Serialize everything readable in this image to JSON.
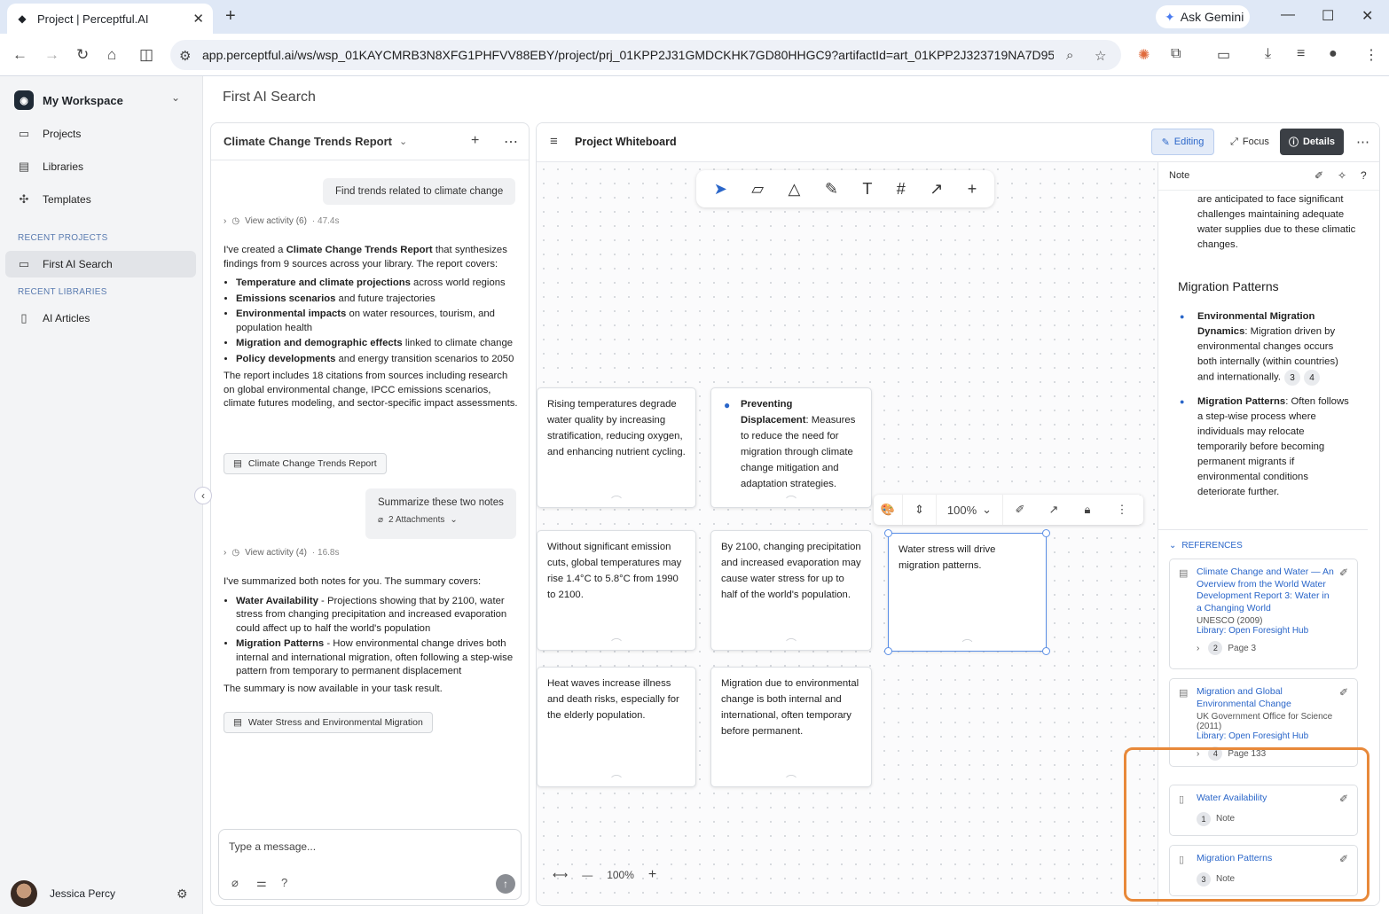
{
  "browser": {
    "tab_title": "Project | Perceptful.AI",
    "ask_gemini": "Ask Gemini",
    "url": "app.perceptful.ai/ws/wsp_01KAYCMRB3N8XFG1PHFVV88EBY/project/prj_01KPP2J31GMDCKHK7GD80HHGC9?artifactId=art_01KPP2J323719NA7D95XEYX..."
  },
  "sidebar": {
    "workspace": "My Workspace",
    "items": [
      {
        "label": "Projects",
        "icon": "folder-icon"
      },
      {
        "label": "Libraries",
        "icon": "library-icon"
      },
      {
        "label": "Templates",
        "icon": "templates-icon"
      }
    ],
    "recent_projects_label": "RECENT PROJECTS",
    "recent_projects": [
      "First AI Search"
    ],
    "recent_libraries_label": "RECENT LIBRARIES",
    "recent_libraries": [
      "AI Articles"
    ],
    "user_name": "Jessica Percy"
  },
  "page_title": "First AI Search",
  "chat": {
    "title": "Climate Change Trends Report",
    "user_msg_1": "Find trends related to climate change",
    "activity_1": "View activity (6)",
    "activity_1_time": "· 47.4s",
    "reply_1_intro_a": "I've created a ",
    "reply_1_intro_b": "Climate Change Trends Report",
    "reply_1_intro_c": " that synthesizes findings from 9 sources across your library. The report covers:",
    "reply_1_bullets": [
      {
        "b": "Temperature and climate projections",
        "t": " across world regions"
      },
      {
        "b": "Emissions scenarios",
        "t": " and future trajectories"
      },
      {
        "b": "Environmental impacts",
        "t": " on water resources, tourism, and population health"
      },
      {
        "b": "Migration and demographic effects",
        "t": " linked to climate change"
      },
      {
        "b": "Policy developments",
        "t": " and energy transition scenarios to 2050"
      }
    ],
    "reply_1_outro": "The report includes 18 citations from sources including research on global environmental change, IPCC emissions scenarios, climate futures modeling, and sector-specific impact assessments.",
    "artifact_1": "Climate Change Trends Report",
    "user_msg_2": "Summarize these two notes",
    "attachments": "2 Attachments",
    "activity_2": "View activity (4)",
    "activity_2_time": "· 16.8s",
    "reply_2_intro": "I've summarized both notes for you. The summary covers:",
    "reply_2_bullets": [
      {
        "b": "Water Availability",
        "t": " - Projections showing that by 2100, water stress from changing precipitation and increased evaporation could affect up to half the world's population"
      },
      {
        "b": "Migration Patterns",
        "t": " - How environmental change drives both internal and international migration, often following a step-wise pattern from temporary to permanent displacement"
      }
    ],
    "reply_2_outro": "The summary is now available in your task result.",
    "artifact_2": "Water Stress and Environmental Migration",
    "composer_placeholder": "Type a message..."
  },
  "whiteboard": {
    "title": "Project Whiteboard",
    "editing": "Editing",
    "focus": "Focus",
    "details": "Details",
    "zoom": "100%",
    "note_zoom": "100%",
    "notes": {
      "n1": "Rising temperatures degrade water quality by increasing stratification, reducing oxygen, and enhancing nutrient cycling.",
      "n2_bold": "Preventing Displacement",
      "n2_text": ": Measures to reduce the need for migration through climate change mitigation and adaptation strategies.",
      "n3": "Without significant emission cuts, global temperatures may rise 1.4°C to 5.8°C from 1990 to 2100.",
      "n4": "By 2100, changing precipitation and increased evaporation may cause water stress for up to half of the world's population.",
      "n5": "Water stress will drive migration patterns.",
      "n6": "Heat waves increase illness and death risks, especially for the elderly population.",
      "n7": "Migration due to environmental change is both internal and international, often temporary before permanent."
    }
  },
  "details_panel": {
    "header": "Note",
    "top_text": "are anticipated to face significant challenges maintaining adequate water supplies due to these climatic changes.",
    "section_title": "Migration Patterns",
    "bullets": [
      {
        "b": "Environmental Migration Dynamics",
        "t": ": Migration driven by environmental changes occurs both internally (within countries) and internationally.",
        "cites": [
          "3",
          "4"
        ]
      },
      {
        "b": "Migration Patterns",
        "t": ": Often follows a step-wise process where individuals may relocate temporarily before becoming permanent migrants if environmental conditions deteriorate further.",
        "cites": []
      }
    ],
    "references_label": "REFERENCES",
    "references": [
      {
        "title": "Climate Change and Water — An Overview from the World Water Development Report 3: Water in a Changing World",
        "source": "UNESCO (2009)",
        "library": "Library: Open Foresight Hub",
        "num": "2",
        "page": "Page 3"
      },
      {
        "title": "Migration and Global Environmental Change",
        "source": "UK Government Office for Science (2011)",
        "library": "Library: Open Foresight Hub",
        "num": "4",
        "page": "Page 133"
      },
      {
        "title": "Water Availability",
        "num": "1",
        "page": "Note"
      },
      {
        "title": "Migration Patterns",
        "num": "3",
        "page": "Note"
      }
    ]
  },
  "colors": {
    "accent": "#2a66c9",
    "highlight": "#e8893a",
    "selection": "#5a8ee6"
  }
}
